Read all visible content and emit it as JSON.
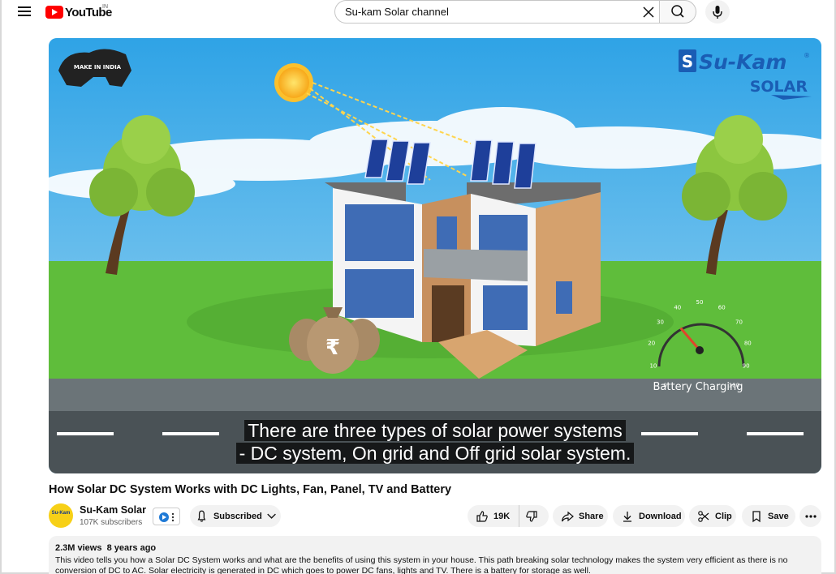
{
  "header": {
    "logo_text": "YouTube",
    "country_code": "IN",
    "search_value": "Su-kam Solar channel"
  },
  "video": {
    "caption_line1": "There are three types of solar power systems",
    "caption_line2": "- DC system, On grid and Off grid solar system.",
    "overlay": {
      "brand_name": "Su-Kam",
      "brand_registered": "®",
      "brand_sub": "SOLAR",
      "make_in_india": "MAKE IN INDIA",
      "battery_label": "Battery Charging",
      "gauge_ticks": [
        "0",
        "10",
        "20",
        "30",
        "40",
        "50",
        "60",
        "70",
        "80",
        "90",
        "100"
      ],
      "gauge_value_fraction": 0.35,
      "currency_symbol": "₹"
    }
  },
  "title": "How Solar DC System Works with DC Lights, Fan, Panel, TV and Battery",
  "channel": {
    "name": "Su-Kam Solar",
    "subscribers": "107K subscribers",
    "avatar_text": "Su-Kam",
    "subscribe_label": "Subscribed"
  },
  "actions": {
    "likes": "19K",
    "share": "Share",
    "download": "Download",
    "clip": "Clip",
    "save": "Save"
  },
  "description": {
    "views": "2.3M views",
    "age": "8 years ago",
    "text": "This video tells you how a Solar DC System works and what are the benefits of using this system in your house. This path breaking solar technology makes the system very efficient as there is no conversion of DC to AC. Solar electricity is generated in DC which goes to power DC fans, lights and TV. There is a battery for storage as well."
  },
  "colors": {
    "youtube_red": "#ff0000",
    "brand_blue": "#1a5db4",
    "sky": "#5cb8e8",
    "grass": "#5fbd3b",
    "road": "#4a5256"
  }
}
